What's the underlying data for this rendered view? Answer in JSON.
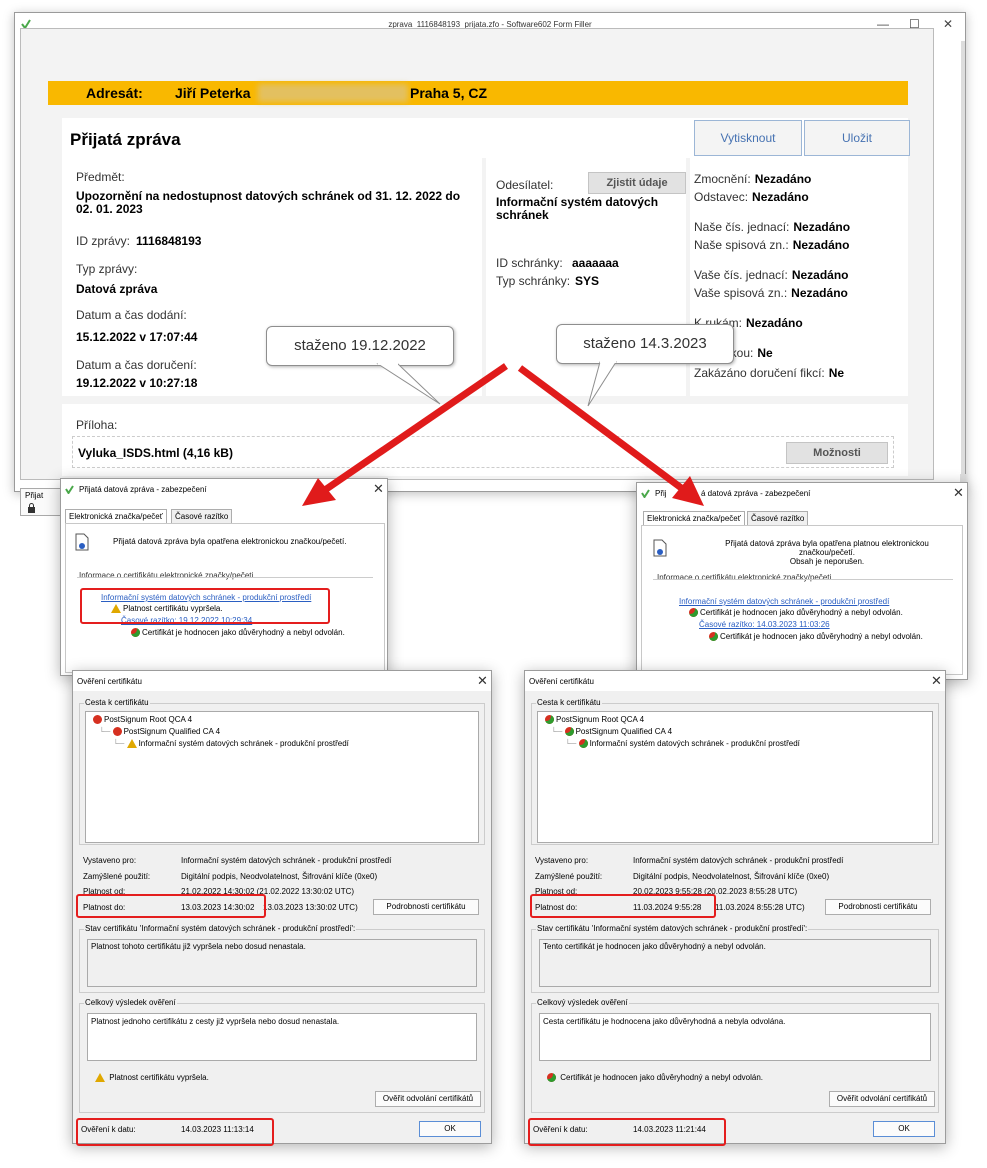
{
  "main_window": {
    "title": "zprava_1116848193_prijata.zfo - Software602 Form Filler",
    "controls": {
      "minimize": "—",
      "maximize": "☐",
      "close": "✕"
    }
  },
  "address_bar": {
    "label": "Adresát:",
    "name": "Jiří Peterka",
    "city": "Praha 5, CZ"
  },
  "heading": "Přijatá zpráva",
  "buttons": {
    "print": "Vytisknout",
    "save": "Uložit",
    "get_info": "Zjistit údaje",
    "options": "Možnosti"
  },
  "left_panel": {
    "subject_label": "Předmět:",
    "subject": "Upozornění na nedostupnost datových schránek od 31. 12. 2022 do 02. 01. 2023",
    "id_label": "ID zprávy:",
    "id": "1116848193",
    "type_label": "Typ zprávy:",
    "type": "Datová zpráva",
    "delivered_label": "Datum a čas dodání:",
    "delivered": "15.12.2022 v 17:07:44",
    "received_label": "Datum a čas doručení:",
    "received": "19.12.2022 v 10:27:18"
  },
  "middle_panel": {
    "sender_label": "Odesílatel:",
    "sender": "Informační systém datových schránek",
    "box_id_label": "ID schránky:",
    "box_id": "aaaaaaa",
    "box_type_label": "Typ schránky:",
    "box_type": "SYS"
  },
  "right_panel": [
    {
      "label": "Zmocnění:",
      "value": "Nezadáno"
    },
    {
      "label": "Odstavec:",
      "value": "Nezadáno"
    },
    {
      "label": "Naše čís. jednací:",
      "value": "Nezadáno"
    },
    {
      "label": "Naše spisová zn.:",
      "value": "Nezadáno"
    },
    {
      "label": "Vaše čís. jednací:",
      "value": "Nezadáno"
    },
    {
      "label": "Vaše spisová zn.:",
      "value": "Nezadáno"
    },
    {
      "label": "K rukám:",
      "value": "Nezadáno"
    },
    {
      "label": "ních rukou:",
      "value": "Ne"
    },
    {
      "label": "Zakázáno doručení fikcí:",
      "value": "Ne"
    }
  ],
  "attachment": {
    "label": "Příloha:",
    "name": "Vyluka_ISDS.html (4,16 kB)"
  },
  "callouts": {
    "left": "staženo 19.12.2022",
    "right": "staženo 14.3.2023"
  },
  "sidebar_stub": {
    "label": "Přijat"
  },
  "security_left": {
    "title": "Přijatá datová zpráva - zabezpečení",
    "tabs": [
      "Elektronická značka/pečeť",
      "Časové razítko"
    ],
    "message": "Přijatá datová zpráva byla opatřena elektronickou značkou/pečetí.",
    "group": "Informace o certifikátu elektronické značky/pečeti",
    "cert_link": "Informační systém datových schránek - produkční prostředí",
    "cert_status": "Platnost certifikátu vypršela.",
    "ts_link": "Časové razítko: 19.12.2022 10:29:34",
    "ts_status": "Certifikát je hodnocen jako důvěryhodný a nebyl odvolán."
  },
  "security_right": {
    "title_prefix": "Přij",
    "title_suffix": "á datová zpráva - zabezpečení",
    "tabs": [
      "Elektronická značka/pečeť",
      "Časové razítko"
    ],
    "message_lines": [
      "Přijatá datová zpráva byla opatřena platnou elektronickou",
      "značkou/pečetí.",
      "Obsah je neporušen."
    ],
    "group": "Informace o certifikátu elektronické značky/pečeti",
    "cert_link": "Informační systém datových schránek - produkční prostředí",
    "cert_status": "Certifikát je hodnocen jako důvěryhodný a nebyl odvolán.",
    "ts_link": "Časové razítko: 14.03.2023 11:03:26",
    "ts_status": "Certifikát je hodnocen jako důvěryhodný a nebyl odvolán."
  },
  "cert_left": {
    "title": "Ověření certifikátu",
    "path_group": "Cesta k certifikátu",
    "path": [
      "PostSignum Root QCA 4",
      "PostSignum Qualified CA 4",
      "Informační systém datových schránek - produkční prostředí"
    ],
    "issued_to_label": "Vystaveno pro:",
    "issued_to": "Informační systém datových schránek - produkční prostředí",
    "purpose_label": "Zamýšlené použití:",
    "purpose": "Digitální podpis, Neodvolatelnost, Šifrování klíče (0xe0)",
    "valid_from_label": "Platnost od:",
    "valid_from": "21.02.2022 14:30:02  (21.02.2022 13:30:02 UTC)",
    "valid_to_label": "Platnost do:",
    "valid_to_a": "13.03.2023 14:30:02",
    "valid_to_b": "13.03.2023 13:30:02 UTC)",
    "details_button": "Podrobnosti certifikátu",
    "status_group": "Stav certifikátu 'Informační systém datových schránek - produkční prostředí':",
    "status_text": "Platnost tohoto certifikátu již vypršela nebo dosud nenastala.",
    "overall_group": "Celkový výsledek ověření",
    "overall_text": "Platnost jednoho certifikátu z cesty již vypršela nebo dosud nenastala.",
    "result": "Platnost certifikátu vypršela.",
    "revocation_button": "Ověřit odvolání certifikátů",
    "date_label": "Ověření k datu:",
    "date": "14.03.2023 11:13:14",
    "ok": "OK"
  },
  "cert_right": {
    "title": "Ověření certifikátu",
    "path_group": "Cesta k certifikátu",
    "path": [
      "PostSignum Root QCA 4",
      "PostSignum Qualified CA 4",
      "Informační systém datových schránek - produkční prostředí"
    ],
    "issued_to_label": "Vystaveno pro:",
    "issued_to": "Informační systém datových schránek - produkční prostředí",
    "purpose_label": "Zamýšlené použití:",
    "purpose": "Digitální podpis, Neodvolatelnost, Šifrování klíče (0xe0)",
    "valid_from_label": "Platnost od:",
    "valid_from": "20.02.2023 9:55:28  (20.02.2023 8:55:28 UTC)",
    "valid_to_label": "Platnost do:",
    "valid_to_a": "11.03.2024 9:55:28",
    "valid_to_b": "11.03.2024 8:55:28 UTC)",
    "details_button": "Podrobnosti certifikátu",
    "status_group": "Stav certifikátu 'Informační systém datových schránek - produkční prostředí':",
    "status_text": "Tento certifikát je hodnocen jako důvěryhodný a nebyl odvolán.",
    "overall_group": "Celkový výsledek ověření",
    "overall_text": "Cesta certifikátu je hodnocena jako důvěryhodná a nebyla odvolána.",
    "result": "Certifikát je hodnocen jako důvěryhodný a nebyl odvolán.",
    "revocation_button": "Ověřit odvolání certifikátů",
    "date_label": "Ověření k datu:",
    "date": "14.03.2023 11:21:44",
    "ok": "OK"
  },
  "colors": {
    "accent_bar": "#f9b800",
    "highlight": "#e41e1e",
    "link": "#2a5ec2",
    "arrow": "#e01b1b"
  }
}
